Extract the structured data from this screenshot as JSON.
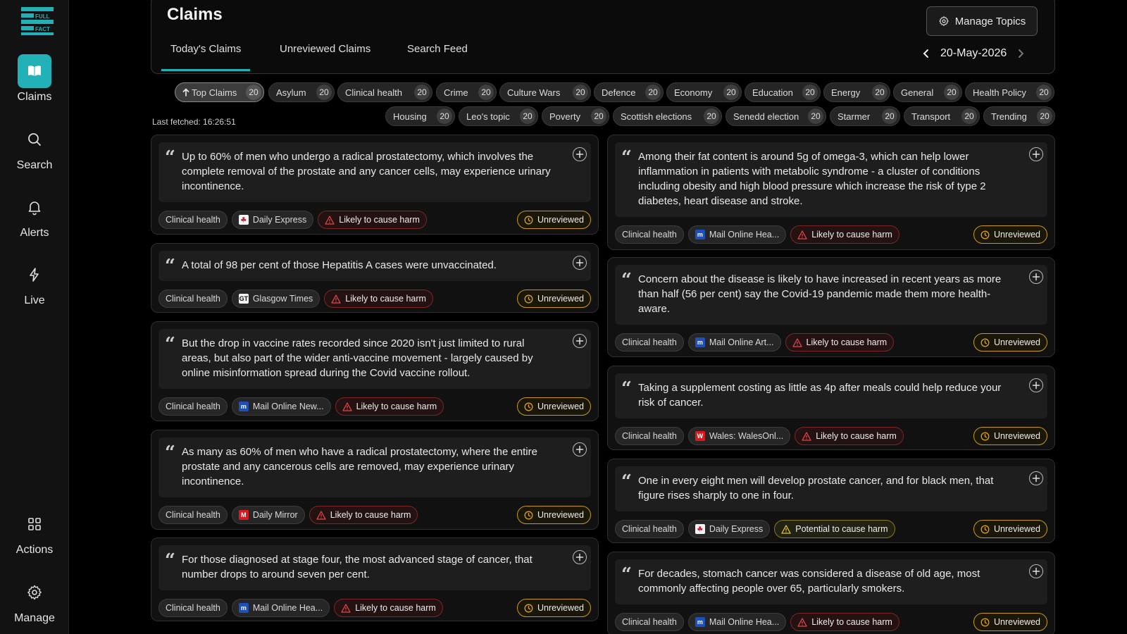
{
  "colors": {
    "accent": "#21b1b6",
    "harm": "#e04848",
    "potential": "#e6c42c",
    "unreviewed": "#d9a21f"
  },
  "sidebar": {
    "logo_text": "FULL FACT",
    "items": [
      {
        "label": "Claims",
        "icon": "book-icon",
        "active": true
      },
      {
        "label": "Search",
        "icon": "search-icon"
      },
      {
        "label": "Alerts",
        "icon": "bell-icon"
      },
      {
        "label": "Live",
        "icon": "lightning-icon"
      },
      {
        "label": "Actions",
        "icon": "grid-icon"
      },
      {
        "label": "Manage",
        "icon": "gear-icon"
      }
    ]
  },
  "header": {
    "title": "Claims",
    "manage_topics": "Manage Topics",
    "tabs": [
      "Today's Claims",
      "Unreviewed Claims",
      "Search Feed"
    ],
    "active_tab": 0,
    "date": "20-May-2026"
  },
  "topics_row1": [
    {
      "label": "Top Claims",
      "count": "20",
      "active": true
    },
    {
      "label": "Asylum",
      "count": "20"
    },
    {
      "label": "Clinical health",
      "count": "20"
    },
    {
      "label": "Crime",
      "count": "20"
    },
    {
      "label": "Culture Wars",
      "count": "20"
    },
    {
      "label": "Defence",
      "count": "20"
    },
    {
      "label": "Economy",
      "count": "20"
    },
    {
      "label": "Education",
      "count": "20"
    },
    {
      "label": "Energy",
      "count": "20"
    },
    {
      "label": "General",
      "count": "20"
    },
    {
      "label": "Health Policy",
      "count": "20"
    }
  ],
  "topics_row2": [
    {
      "label": "Housing",
      "count": "20"
    },
    {
      "label": "Leo's topic",
      "count": "20"
    },
    {
      "label": "Poverty",
      "count": "20"
    },
    {
      "label": "Scottish elections",
      "count": "20"
    },
    {
      "label": "Senedd election",
      "count": "20"
    },
    {
      "label": "Starmer",
      "count": "20"
    },
    {
      "label": "Transport",
      "count": "20"
    },
    {
      "label": "Trending",
      "count": "20"
    }
  ],
  "last_fetched": "Last fetched: 16:26:51",
  "left_claims": [
    {
      "text": "Up to 60% of men who undergo a radical prostatectomy, which involves the complete removal of the prostate and any cancer cells, may experience urinary incontinence.",
      "topic": "Clinical health",
      "source": "Daily Express",
      "source_logo": "daily-express-logo",
      "harm": "Likely to cause harm",
      "harm_level": "likely",
      "status": "Unreviewed"
    },
    {
      "text": "A total of 98 per cent of those Hepatitis A cases were unvaccinated.",
      "topic": "Clinical health",
      "source": "Glasgow Times",
      "source_logo": "glasgow-times-logo",
      "harm": "Likely to cause harm",
      "harm_level": "likely",
      "status": "Unreviewed"
    },
    {
      "text": "But the drop in vaccine rates recorded since 2020 isn't just limited to rural areas, but also part of the wider anti-vaccine movement - largely caused by online misinformation spread during the Covid vaccine rollout.",
      "topic": "Clinical health",
      "source": "Mail Online New...",
      "source_logo": "mail-online-logo",
      "harm": "Likely to cause harm",
      "harm_level": "likely",
      "status": "Unreviewed"
    },
    {
      "text": "As many as 60% of men who have a radical prostatectomy, where the entire prostate and any cancerous cells are removed, may experience urinary incontinence.",
      "topic": "Clinical health",
      "source": "Daily Mirror",
      "source_logo": "daily-mirror-logo",
      "harm": "Likely to cause harm",
      "harm_level": "likely",
      "status": "Unreviewed"
    },
    {
      "text": "For those diagnosed at stage four, the most advanced stage of cancer, that number drops to around seven per cent.",
      "topic": "Clinical health",
      "source": "Mail Online Hea...",
      "source_logo": "mail-online-logo",
      "harm": "Likely to cause harm",
      "harm_level": "likely",
      "status": "Unreviewed"
    }
  ],
  "right_claims": [
    {
      "text": "Among their fat content is around 5g of omega-3, which can help lower inflammation in patients with metabolic syndrome - a cluster of conditions including obesity and high blood pressure which increase the risk of type 2 diabetes, heart disease and stroke.",
      "topic": "Clinical health",
      "source": "Mail Online Hea...",
      "source_logo": "mail-online-logo",
      "harm": "Likely to cause harm",
      "harm_level": "likely",
      "status": "Unreviewed"
    },
    {
      "text": "Concern about the disease is likely to have increased in recent years as more than half (56 per cent) say the Covid-19 pandemic made them more health-aware.",
      "topic": "Clinical health",
      "source": "Mail Online Art...",
      "source_logo": "mail-online-logo",
      "harm": "Likely to cause harm",
      "harm_level": "likely",
      "status": "Unreviewed"
    },
    {
      "text": "Taking a supplement costing as little as 4p after meals could help reduce your risk of cancer.",
      "topic": "Clinical health",
      "source": "Wales: WalesOnl...",
      "source_logo": "wales-online-logo",
      "harm": "Likely to cause harm",
      "harm_level": "likely",
      "status": "Unreviewed"
    },
    {
      "text": "One in every eight men will develop prostate cancer, and for black men, that figure rises sharply to one in four.",
      "topic": "Clinical health",
      "source": "Daily Express",
      "source_logo": "daily-express-logo",
      "harm": "Potential to cause harm",
      "harm_level": "potential",
      "status": "Unreviewed"
    },
    {
      "text": "For decades, stomach cancer was considered a disease of old age, most commonly affecting people over 65, particularly smokers.",
      "topic": "Clinical health",
      "source": "Mail Online Hea...",
      "source_logo": "mail-online-logo",
      "harm": "Likely to cause harm",
      "harm_level": "likely",
      "status": "Unreviewed"
    }
  ]
}
